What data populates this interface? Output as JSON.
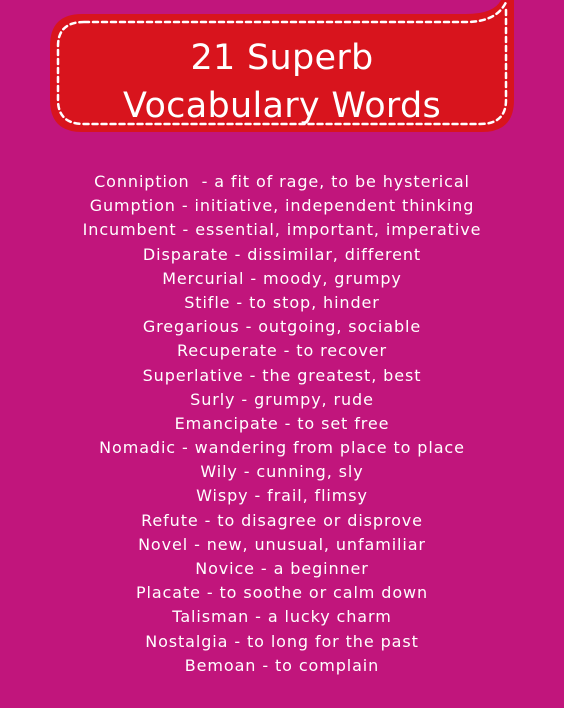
{
  "colors": {
    "background": "#c1157c",
    "banner": "#d8141d",
    "banner_stitch": "#ffffff",
    "text": "#ffffff"
  },
  "title": {
    "line1": "21 Superb",
    "line2": "Vocabulary Words"
  },
  "words": [
    "Conniption  - a fit of rage, to be hysterical",
    "Gumption - initiative, independent thinking",
    "Incumbent - essential, important, imperative",
    "Disparate - dissimilar, different",
    "Mercurial - moody, grumpy",
    "Stifle - to stop, hinder",
    "Gregarious - outgoing, sociable",
    "Recuperate - to recover",
    "Superlative - the greatest, best",
    "Surly - grumpy, rude",
    "Emancipate - to set free",
    "Nomadic - wandering from place to place",
    "Wily - cunning, sly",
    "Wispy - frail, flimsy",
    "Refute - to disagree or disprove",
    "Novel - new, unusual, unfamiliar",
    "Novice - a beginner",
    "Placate - to soothe or calm down",
    "Talisman - a lucky charm",
    "Nostalgia - to long for the past",
    "Bemoan - to complain"
  ]
}
